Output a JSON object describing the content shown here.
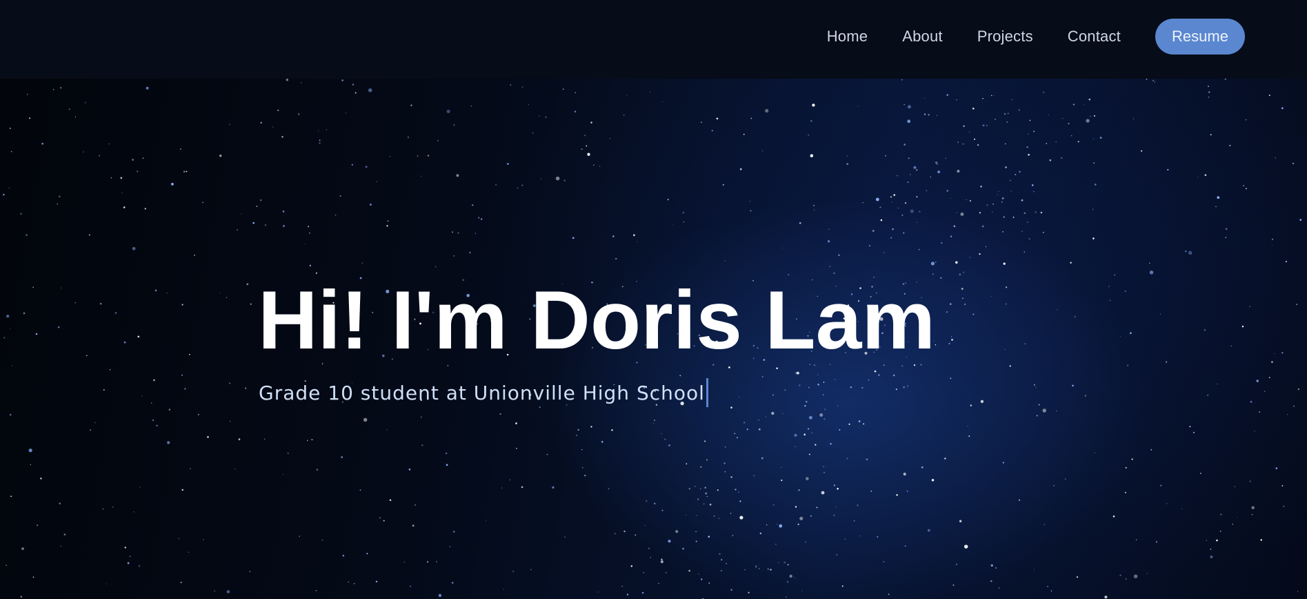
{
  "nav": {
    "links": [
      "Home",
      "About",
      "Projects",
      "Contact"
    ],
    "resume_label": "Resume"
  },
  "hero": {
    "title": "Hi! I'm Doris Lam",
    "subtitle": "Grade 10 student at Unionville High School"
  },
  "colors": {
    "navbar_bg": "#060c18",
    "accent": "#5a87d0",
    "title_text": "#ffffff",
    "subtitle_text": "#cfe0f7",
    "nav_text": "#cfd6e6"
  }
}
